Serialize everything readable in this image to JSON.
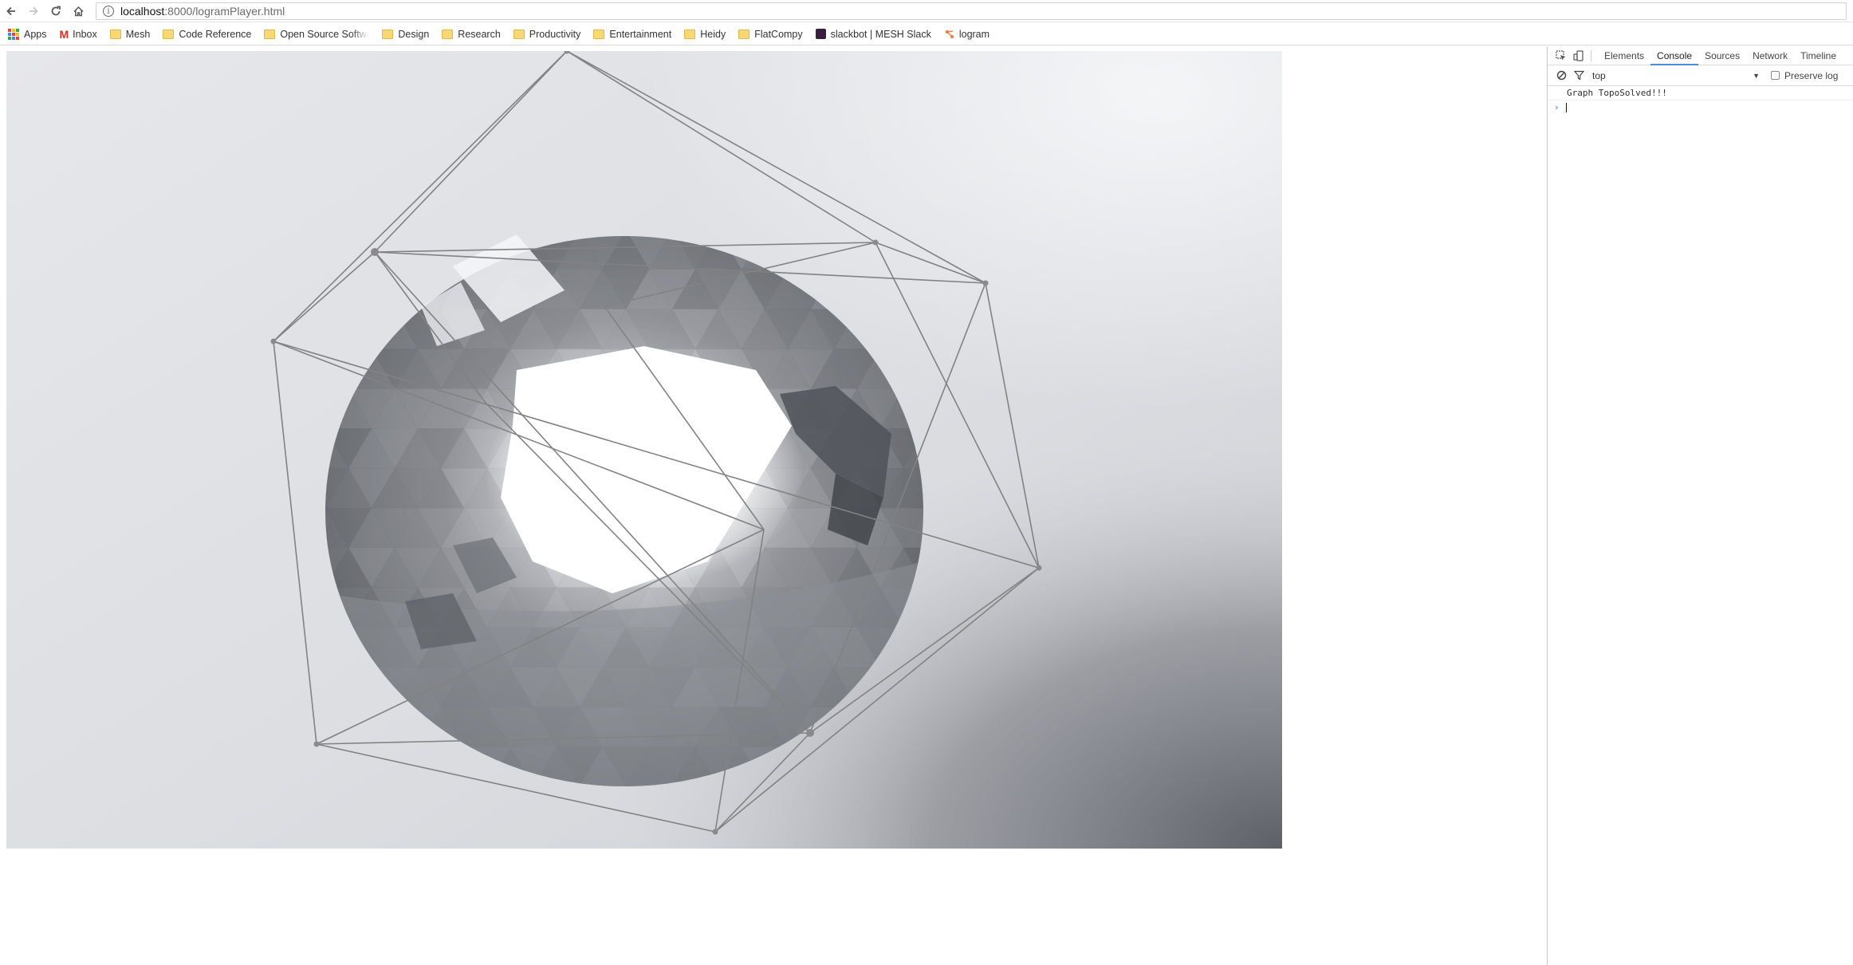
{
  "browser": {
    "url_host": "localhost",
    "url_path": ":8000/logramPlayer.html",
    "info_glyph": "i"
  },
  "bookmarks": [
    {
      "label": "Apps",
      "icon": "apps-grid-icon"
    },
    {
      "label": "Inbox",
      "icon": "gmail-icon"
    },
    {
      "label": "Mesh",
      "icon": "folder-icon"
    },
    {
      "label": "Code Reference",
      "icon": "folder-icon"
    },
    {
      "label": "Open Source Softwar",
      "icon": "folder-icon"
    },
    {
      "label": "Design",
      "icon": "folder-icon"
    },
    {
      "label": "Research",
      "icon": "folder-icon"
    },
    {
      "label": "Productivity",
      "icon": "folder-icon"
    },
    {
      "label": "Entertainment",
      "icon": "folder-icon"
    },
    {
      "label": "Heidy",
      "icon": "folder-icon"
    },
    {
      "label": "FlatCompy",
      "icon": "folder-icon"
    },
    {
      "label": "slackbot | MESH Slack",
      "icon": "slack-icon"
    },
    {
      "label": "logram",
      "icon": "logram-icon"
    }
  ],
  "devtools": {
    "tabs": [
      "Elements",
      "Console",
      "Sources",
      "Network",
      "Timeline"
    ],
    "active_tab": "Console",
    "context": "top",
    "preserve_log_label": "Preserve log",
    "preserve_log_checked": false,
    "console_messages": [
      "Graph TopoSolved!!!"
    ],
    "prompt_glyph": "›"
  },
  "colors": {
    "accent": "#4a90d9",
    "canvas_bg": "#dfe1e5",
    "wire": "#7f7f7f",
    "sphere_base": "#8c8f94"
  }
}
